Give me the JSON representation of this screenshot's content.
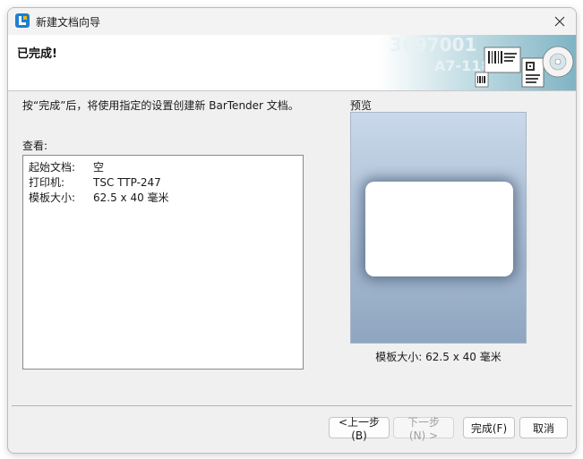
{
  "window": {
    "title": "新建文档向导",
    "brand_color": "#1e7fd0"
  },
  "header": {
    "title": "已完成!",
    "graphic_texts": [
      "3697001",
      "A7-118"
    ]
  },
  "main": {
    "instruction": "按“完成”后，将使用指定的设置创建新 BarTender 文档。",
    "review_label": "查看:",
    "summary": [
      {
        "key": "起始文档:",
        "value": "空"
      },
      {
        "key": "打印机:",
        "value": "TSC TTP-247"
      },
      {
        "key": "模板大小:",
        "value": "62.5 x 40 毫米"
      }
    ]
  },
  "preview": {
    "label": "预览",
    "template_size": "模板大小: 62.5 x 40 毫米"
  },
  "buttons": {
    "back": "<上一步(B)",
    "next": "下一步(N) >",
    "finish": "完成(F)",
    "cancel": "取消"
  }
}
